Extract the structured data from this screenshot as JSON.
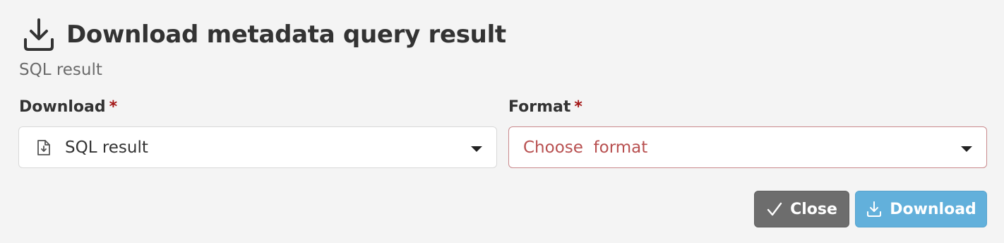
{
  "dialog": {
    "title": "Download metadata query result",
    "subtitle": "SQL result",
    "header_icon": "download-tray-icon"
  },
  "fields": {
    "download": {
      "label": "Download",
      "required_mark": "*",
      "value": "SQL result",
      "icon": "file-download-icon"
    },
    "format": {
      "label": "Format",
      "required_mark": "*",
      "placeholder": "Choose  format"
    }
  },
  "buttons": {
    "close": {
      "label": "Close",
      "icon": "check-icon"
    },
    "download": {
      "label": "Download",
      "icon": "download-icon"
    }
  },
  "colors": {
    "background": "#f4f4f4",
    "required": "#a31515",
    "error_border": "#c9898c",
    "error_text": "#b85050",
    "close_button": "#6d6d6d",
    "download_button": "#62b0db"
  }
}
